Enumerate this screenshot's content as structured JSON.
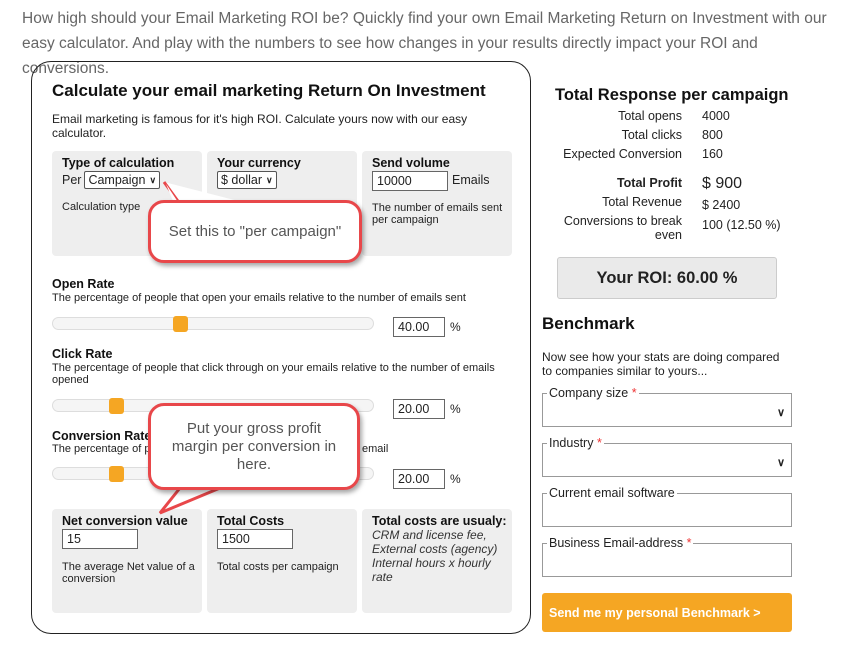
{
  "intro": "How high should your Email Marketing ROI be? Quickly find your own Email Marketing Return on Investment with our easy calculator. And play with the numbers to see how changes in your results directly impact your ROI and conversions.",
  "calc": {
    "title": "Calculate your email marketing Return On Investment",
    "description": "Email marketing is famous for it's high ROI. Calculate yours now with our easy calculator.",
    "type": {
      "label": "Type of calculation",
      "prefix": "Per",
      "value": "Campaign",
      "help": "Calculation type"
    },
    "currency": {
      "label": "Your currency",
      "value": "$ dollar"
    },
    "volume": {
      "label": "Send volume",
      "value": "10000",
      "unit": "Emails",
      "help": "The number of emails sent per campaign"
    },
    "open": {
      "label": "Open Rate",
      "help": "The percentage of people that open your emails relative to the number of emails sent",
      "value": "40.00",
      "percent": 40,
      "unit": "%"
    },
    "click": {
      "label": "Click Rate",
      "help": "The percentage of people that click through on your emails relative to the number of emails opened",
      "value": "20.00",
      "percent": 20,
      "unit": "%"
    },
    "conversion": {
      "label": "Conversion Rate",
      "help_start": "The percentage of p",
      "help_end": "email",
      "value": "20.00",
      "percent": 20,
      "unit": "%"
    },
    "net": {
      "label": "Net conversion value",
      "value": "15",
      "help": "The average Net value of a conversion"
    },
    "costs": {
      "label": "Total Costs",
      "value": "1500",
      "help": "Total costs per campaign"
    },
    "costs_info": {
      "label": "Total costs are usualy:",
      "text": "CRM and license fee, External costs (agency) Internal hours x hourly rate"
    }
  },
  "callouts": [
    "Set this to \"per campaign\"",
    "Put your gross profit margin per conversion in here."
  ],
  "results": {
    "title": "Total Response per campaign",
    "rows": [
      {
        "label": "Total opens",
        "value": "4000"
      },
      {
        "label": "Total clicks",
        "value": "800"
      },
      {
        "label": "Expected Conversion",
        "value": "160"
      }
    ],
    "profit_label": "Total Profit",
    "profit": "$ 900",
    "revenue_label": "Total Revenue",
    "revenue": "$ 2400",
    "breakeven_label": "Conversions to break even",
    "breakeven": "100 (12.50 %)",
    "roi": "Your ROI: 60.00 %"
  },
  "benchmark": {
    "title": "Benchmark",
    "description": "Now see how your stats are doing compared to companies similar to yours...",
    "fields": [
      {
        "label": "Company size",
        "required": "*"
      },
      {
        "label": "Industry",
        "required": "*"
      },
      {
        "label": "Current email software",
        "required": ""
      },
      {
        "label": "Business Email-address",
        "required": "*"
      }
    ],
    "button": "Send me my personal Benchmark >"
  },
  "colors": {
    "accent": "#f5a623",
    "callout": "#e8474a"
  }
}
